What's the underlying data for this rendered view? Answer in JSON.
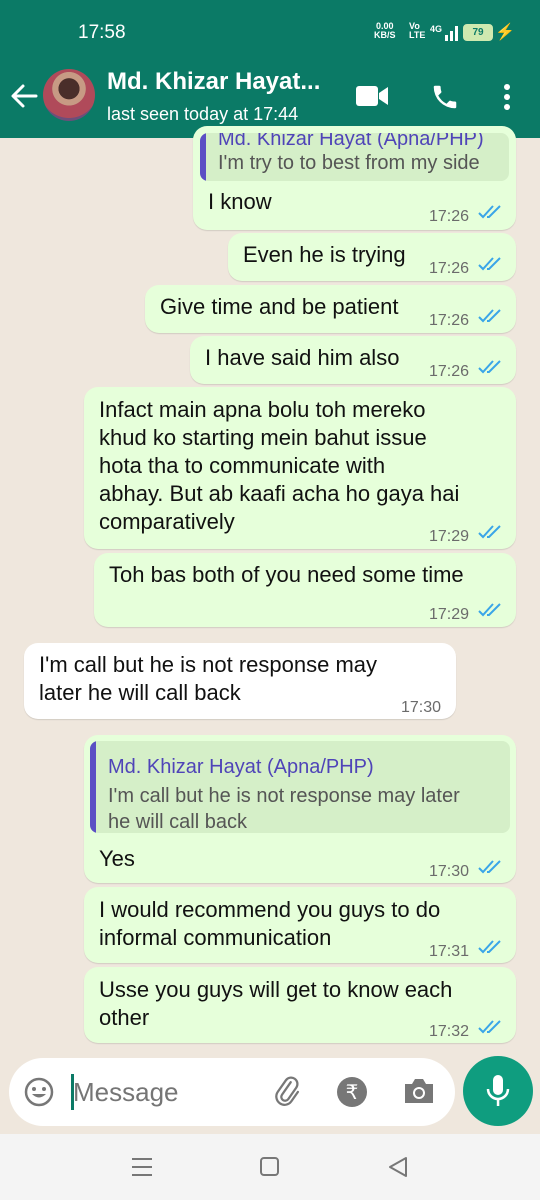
{
  "status": {
    "time": "17:58",
    "net_speed": "0.00",
    "net_unit": "KB/S",
    "volte": "Vo LTE",
    "signal": "4G",
    "battery": "79"
  },
  "header": {
    "contact_name": "Md. Khizar Hayat...",
    "last_seen": "last seen today at 17:44"
  },
  "messages": [
    {
      "dir": "out",
      "quote_text": "I'm try to to best from my side",
      "quote_name": "Md. Khizar Hayat (Apna/PHP)",
      "text": "I know",
      "time": "17:26"
    },
    {
      "dir": "out",
      "text": "Even he is trying",
      "time": "17:26"
    },
    {
      "dir": "out",
      "text": "Give time and be patient",
      "time": "17:26"
    },
    {
      "dir": "out",
      "text": "I have said him also",
      "time": "17:26"
    },
    {
      "dir": "out",
      "text": "Infact main apna bolu toh mereko\nkhud ko starting mein bahut issue\nhota tha to communicate with\nabhay. But ab kaafi acha ho gaya hai\ncomparatively",
      "time": "17:29"
    },
    {
      "dir": "out",
      "text": "Toh bas both of you need some time",
      "time": "17:29"
    },
    {
      "dir": "in",
      "text": "I'm call but he is not response may\nlater he will call back",
      "time": "17:30"
    },
    {
      "dir": "out",
      "quote_name": "Md. Khizar Hayat (Apna/PHP)",
      "quote_text": "I'm call but he is not response may later\nhe will call back",
      "text": "Yes",
      "time": "17:30"
    },
    {
      "dir": "out",
      "text": "I would recommend you guys to do\ninformal communication",
      "time": "17:31"
    },
    {
      "dir": "out",
      "text": "Usse you guys will get to know each\nother",
      "time": "17:32"
    }
  ],
  "composer": {
    "placeholder": "Message"
  },
  "colors": {
    "header": "#0b7a66",
    "outgoing_bubble": "#e6ffda",
    "incoming_bubble": "#ffffff",
    "read_ticks": "#3aa5e8",
    "mic_button": "#0f9d7f"
  }
}
